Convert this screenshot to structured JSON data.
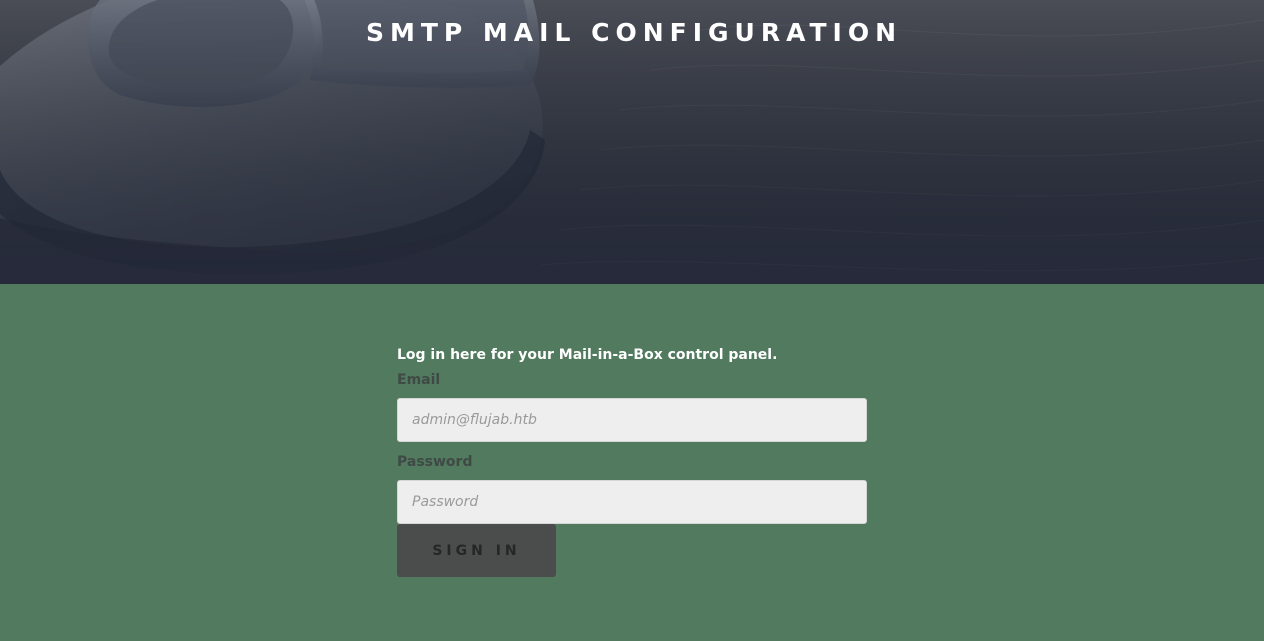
{
  "header": {
    "title": "SMTP MAIL CONFIGURATION"
  },
  "login": {
    "intro": "Log in here for your Mail-in-a-Box control panel.",
    "email_label": "Email",
    "email_placeholder": "admin@flujab.htb",
    "email_value": "",
    "password_label": "Password",
    "password_placeholder": "Password",
    "password_value": "",
    "submit_label": "SIGN IN"
  },
  "colors": {
    "hero_background": "#3e434f",
    "panel_background": "#517a5e",
    "input_background": "#eeeeee",
    "button_background": "#4a4d4c"
  },
  "icons": {
    "hero_image": "at-symbol-icon"
  }
}
